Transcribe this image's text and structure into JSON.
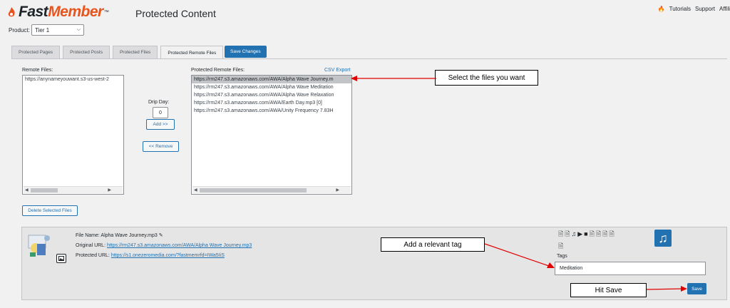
{
  "header": {
    "logo_text_1": "Fast",
    "logo_text_2": "Member",
    "logo_tm": "™",
    "page_title": "Protected Content",
    "links": [
      "Tutorials",
      "Support",
      "Affili"
    ]
  },
  "product": {
    "label": "Product:",
    "selected": "Tier 1"
  },
  "tabs": [
    {
      "label": "Protected Pages"
    },
    {
      "label": "Protected Posts"
    },
    {
      "label": "Protected Files"
    },
    {
      "label": "Protected Remote Files"
    }
  ],
  "save_changes_label": "Save Changes",
  "remote_files": {
    "label": "Remote Files:",
    "items": [
      "https://anynameyouwant.s3-us-west-2"
    ]
  },
  "drip": {
    "label": "Drip Day:",
    "value": "0",
    "add_label": "Add >>",
    "remove_label": "<< Remove"
  },
  "protected_remote_files": {
    "label": "Protected Remote Files:",
    "csv_export": "CSV Export",
    "items": [
      "https://rm247.s3.amazonaws.com/AWA/Alpha Wave Journey.m",
      "https://rm247.s3.amazonaws.com/AWA/Alpha Wave Meditation",
      "https://rm247.s3.amazonaws.com/AWA/Alpha Wave Relaxation",
      "https://rm247.s3.amazonaws.com/AWA/Earth Day.mp3 [0]",
      "https://rm247.s3.amazonaws.com/AWA/Unity Frequency 7.83H"
    ],
    "selected_index": 0
  },
  "delete_selected_label": "Delete Selected Files",
  "file_detail": {
    "file_name_label": "File Name:",
    "file_name": "Alpha Wave Journey.mp3",
    "original_url_label": "Original URL:",
    "original_url": "https://rm247.s3.amazonaws.com/AWA/Alpha Wave Journey.mp3",
    "protected_url_label": "Protected URL:",
    "protected_url": "https://s1.onezeromedia.com/?fastmemrfd=IWa5IiS",
    "tags_label": "Tags",
    "tags_value": "Meditation",
    "save_label": "Save"
  },
  "callouts": {
    "select_files": "Select the files you want",
    "add_tag": "Add a relevant tag",
    "hit_save": "Hit Save"
  },
  "colors": {
    "accent": "#2271b1",
    "brand_orange": "#e8541c",
    "arrow": "#e00000"
  }
}
